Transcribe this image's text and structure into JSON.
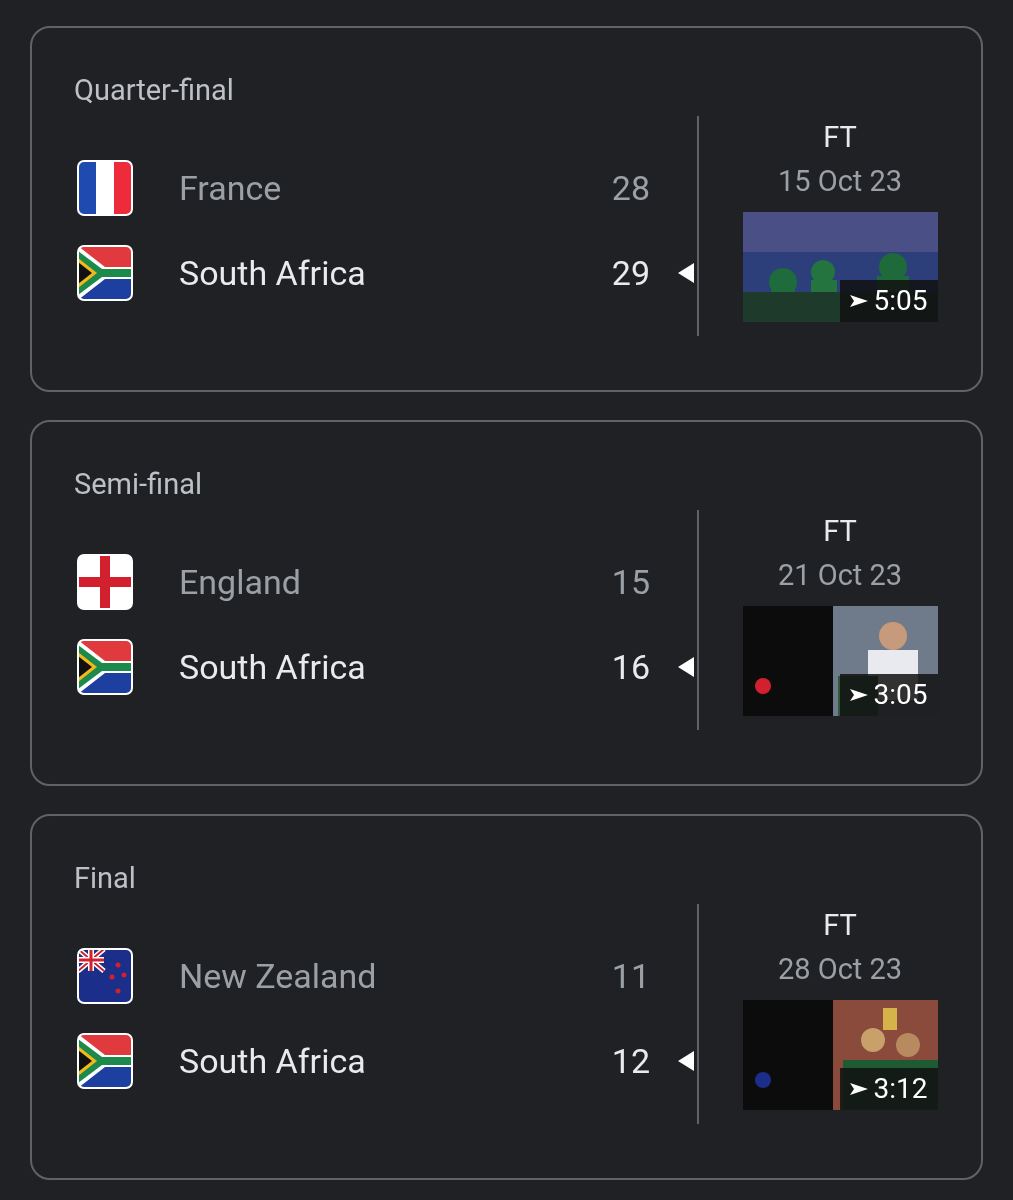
{
  "matches": [
    {
      "stage": "Quarter-final",
      "teams": [
        {
          "kind": "france",
          "name": "France",
          "score": "28",
          "winner": false
        },
        {
          "kind": "south_africa",
          "name": "South Africa",
          "score": "29",
          "winner": true
        }
      ],
      "status": "FT",
      "date": "15 Oct 23",
      "video": {
        "kind": "picture",
        "duration": "5:05"
      }
    },
    {
      "stage": "Semi-final",
      "teams": [
        {
          "kind": "england",
          "name": "England",
          "score": "15",
          "winner": false
        },
        {
          "kind": "south_africa",
          "name": "South Africa",
          "score": "16",
          "winner": true
        }
      ],
      "status": "FT",
      "date": "21 Oct 23",
      "video": {
        "kind": "picture",
        "duration": "3:05"
      }
    },
    {
      "stage": "Final",
      "teams": [
        {
          "kind": "new_zealand",
          "name": "New Zealand",
          "score": "11",
          "winner": false
        },
        {
          "kind": "south_africa",
          "name": "South Africa",
          "score": "12",
          "winner": true
        }
      ],
      "status": "FT",
      "date": "28 Oct 23",
      "video": {
        "kind": "picture",
        "duration": "3:12"
      }
    }
  ]
}
